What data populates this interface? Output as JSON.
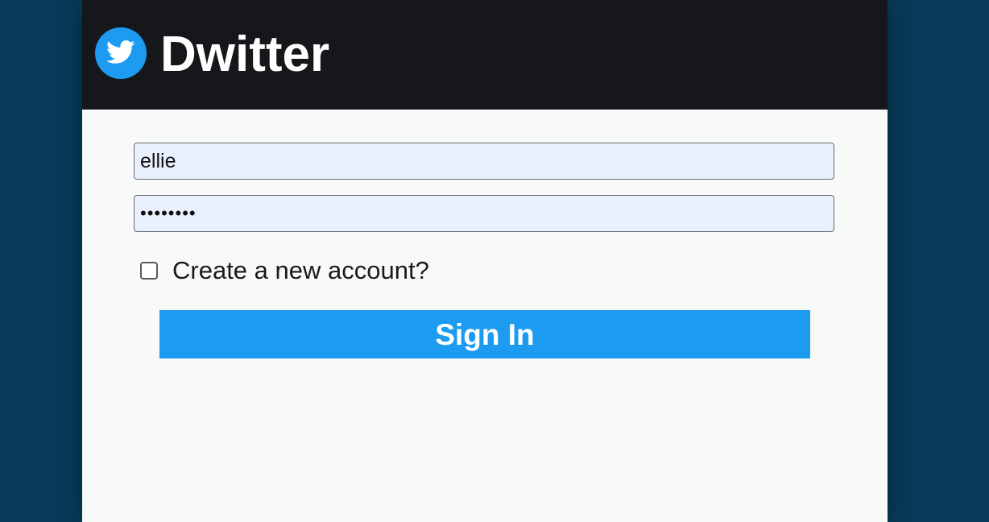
{
  "header": {
    "brand": "Dwitter",
    "logo_icon": "bird-icon"
  },
  "login": {
    "username_value": "ellie",
    "password_value": "••••••••",
    "create_account_label": "Create a new account?",
    "create_account_checked": false,
    "signin_label": "Sign In"
  },
  "colors": {
    "accent": "#1d9bf0",
    "header_bg": "#15171b",
    "page_bg": "#073b59",
    "input_bg": "#e8f0fe"
  }
}
